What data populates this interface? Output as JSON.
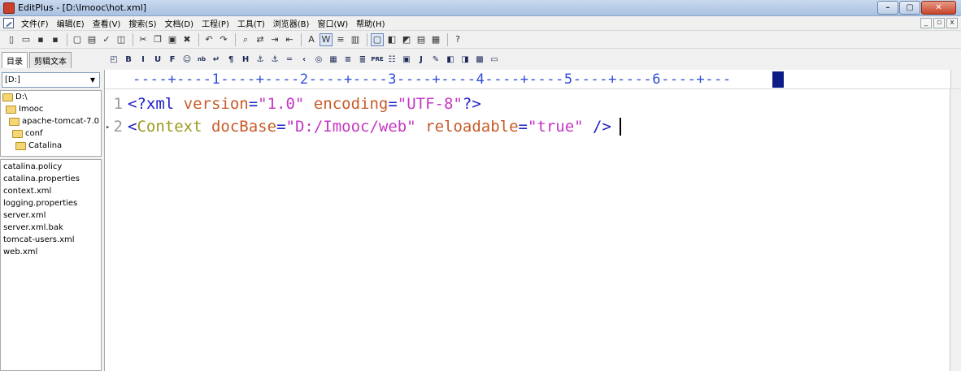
{
  "window": {
    "title": "EditPlus - [D:\\Imooc\\hot.xml]",
    "min_label": "–",
    "max_label": "▢",
    "close_label": "✕"
  },
  "menu": {
    "items": [
      "文件(F)",
      "编辑(E)",
      "查看(V)",
      "搜索(S)",
      "文档(D)",
      "工程(P)",
      "工具(T)",
      "浏览器(B)",
      "窗口(W)",
      "帮助(H)"
    ],
    "mdi_min": "_",
    "mdi_restore": "▫",
    "mdi_close": "x"
  },
  "left_panel": {
    "tab_directory": "目录",
    "tab_clip": "剪辑文本",
    "drive": "[D:]",
    "tree": [
      {
        "label": "D:\\",
        "indent": 0
      },
      {
        "label": "Imooc",
        "indent": 1
      },
      {
        "label": "apache-tomcat-7.0",
        "indent": 2
      },
      {
        "label": "conf",
        "indent": 3
      },
      {
        "label": "Catalina",
        "indent": 4
      }
    ],
    "files": [
      "catalina.policy",
      "catalina.properties",
      "context.xml",
      "logging.properties",
      "server.xml",
      "server.xml.bak",
      "tomcat-users.xml",
      "web.xml"
    ]
  },
  "editor": {
    "ruler": "----+----1----+----2----+----3----+----4----+----5----+----6----+---",
    "lines": [
      {
        "number": "1",
        "parts": [
          {
            "cls": "tag",
            "text": "<?xml "
          },
          {
            "cls": "attr",
            "text": "version"
          },
          {
            "cls": "tag",
            "text": "="
          },
          {
            "cls": "str",
            "text": "\"1.0\""
          },
          {
            "cls": "tag",
            "text": " "
          },
          {
            "cls": "attr",
            "text": "encoding"
          },
          {
            "cls": "tag",
            "text": "="
          },
          {
            "cls": "str",
            "text": "\"UTF-8\""
          },
          {
            "cls": "tag",
            "text": "?>"
          }
        ]
      },
      {
        "number": "2",
        "parts": [
          {
            "cls": "tag",
            "text": "<"
          },
          {
            "cls": "tagname",
            "text": "Context"
          },
          {
            "cls": "tag",
            "text": " "
          },
          {
            "cls": "attr",
            "text": "docBase"
          },
          {
            "cls": "tag",
            "text": "="
          },
          {
            "cls": "str",
            "text": "\"D:/Imooc/web\""
          },
          {
            "cls": "tag",
            "text": " "
          },
          {
            "cls": "attr",
            "text": "reloadable"
          },
          {
            "cls": "tag",
            "text": "="
          },
          {
            "cls": "str",
            "text": "\"true\""
          },
          {
            "cls": "tag",
            "text": " />"
          }
        ]
      }
    ]
  },
  "toolbar": {
    "icons": [
      "new-file-icon",
      "open-icon",
      "save-icon",
      "save-all-icon",
      "print-preview-icon",
      "print-icon",
      "spell-check-icon",
      "browser-icon",
      "cut-icon",
      "copy-icon",
      "paste-icon",
      "delete-icon",
      "undo-icon",
      "redo-icon",
      "find-icon",
      "replace-icon",
      "goto-icon",
      "indent-icon",
      "font-icon",
      "word-wrap-icon",
      "line-number-icon",
      "column-icon",
      "screen-icon",
      "window-icon",
      "full-screen-icon",
      "cliptext-icon",
      "directory-icon",
      "help-icon"
    ]
  },
  "format_toolbar": {
    "icons": [
      "preview-icon",
      "bold-icon",
      "italic-icon",
      "underline-icon",
      "font-icon",
      "color-icon",
      "nbsp-icon",
      "break-icon",
      "paragraph-icon",
      "heading-icon",
      "link-icon",
      "anchor-icon",
      "hr-icon",
      "comment-icon",
      "image-icon",
      "table-icon",
      "center-icon",
      "align-icon",
      "pre-icon",
      "list-icon",
      "form-icon",
      "java-icon",
      "script-icon",
      "tag-icon",
      "close-tag-icon",
      "color-picker-icon",
      "frame-icon"
    ]
  }
}
